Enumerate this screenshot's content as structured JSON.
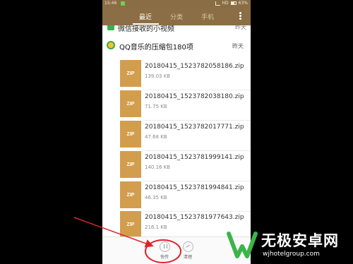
{
  "status": {
    "time": "15:46",
    "network": "HD",
    "battery": "63%"
  },
  "tabs": [
    {
      "label": "最近"
    },
    {
      "label": "分类"
    },
    {
      "label": "手机"
    }
  ],
  "partial_group": {
    "title": "微信接收的小视频",
    "date": "昨天"
  },
  "group": {
    "title": "QQ音乐的压缩包180项",
    "date": "昨天"
  },
  "files": [
    {
      "icon_label": "ZIP",
      "name": "20180415_1523782058186.zip",
      "size": "139.03 KB"
    },
    {
      "icon_label": "ZIP",
      "name": "20180415_1523782038180.zip",
      "size": "71.75 KB"
    },
    {
      "icon_label": "ZIP",
      "name": "20180415_1523782017771.zip",
      "size": "47.68 KB"
    },
    {
      "icon_label": "ZIP",
      "name": "20180415_1523781999141.zip",
      "size": "140.16 KB"
    },
    {
      "icon_label": "ZIP",
      "name": "20180415_1523781994841.zip",
      "size": "46.35 KB"
    },
    {
      "icon_label": "ZIP",
      "name": "20180415_1523781977643.zip",
      "size": "216.1 KB"
    }
  ],
  "bottom_actions": [
    {
      "label": "快传",
      "icon": "send-icon"
    },
    {
      "label": "清理",
      "icon": "clean-icon"
    }
  ],
  "watermark": {
    "title": "无极安卓网",
    "url": "wjhotelgroup.com"
  },
  "colors": {
    "header": "#8b6e45",
    "zip": "#d39d4e",
    "annotation": "#e0232a",
    "wechat": "#35b24a"
  }
}
